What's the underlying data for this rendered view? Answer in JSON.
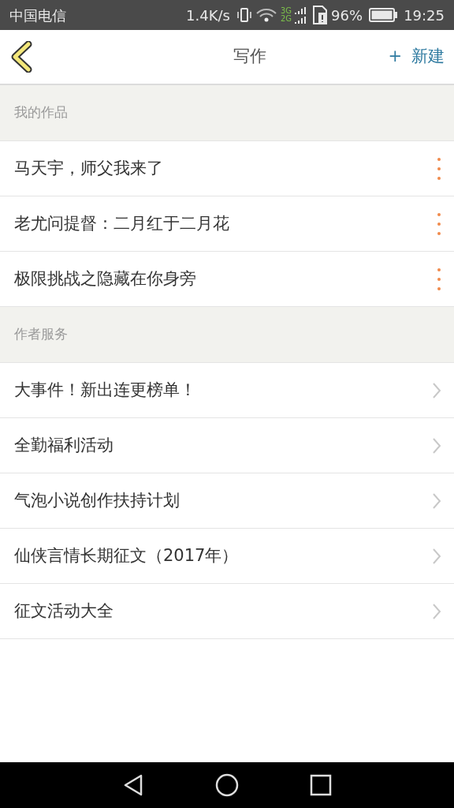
{
  "status_bar": {
    "carrier": "中国电信",
    "speed": "1.4K/s",
    "network_top": "3G",
    "network_bottom": "2G",
    "battery": "96%",
    "time": "19:25"
  },
  "header": {
    "title": "写作",
    "action_icon": "+",
    "action": "新建"
  },
  "sections": [
    {
      "title": "我的作品",
      "kind": "works",
      "items": [
        "马天宇，师父我来了",
        "老尤问提督：二月红于二月花",
        "极限挑战之隐藏在你身旁"
      ]
    },
    {
      "title": "作者服务",
      "kind": "links",
      "items": [
        "大事件！新出连更榜单！",
        "全勤福利活动",
        "气泡小说创作扶持计划",
        "仙侠言情长期征文（2017年）",
        "征文活动大全"
      ]
    }
  ]
}
